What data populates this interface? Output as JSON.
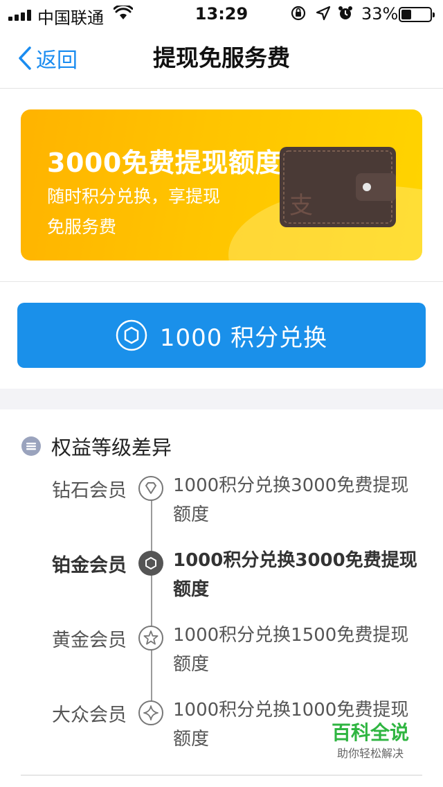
{
  "status_bar": {
    "carrier": "中国联通",
    "time": "13:29",
    "battery_percent": "33%"
  },
  "nav": {
    "back_label": "返回",
    "title": "提现免服务费"
  },
  "banner": {
    "title": "3000免费提现额度",
    "subtitle": "随时积分兑换，享提现免服务费"
  },
  "exchange_button": {
    "label": "1000 积分兑换"
  },
  "benefits": {
    "title": "权益等级差异",
    "tiers": [
      {
        "name": "钻石会员",
        "desc": "1000积分兑换3000免费提现额度",
        "icon": "diamond-icon",
        "active": false
      },
      {
        "name": "铂金会员",
        "desc": "1000积分兑换3000免费提现额度",
        "icon": "hexagon-icon",
        "active": true
      },
      {
        "name": "黄金会员",
        "desc": "1000积分兑换1500免费提现额度",
        "icon": "star-icon",
        "active": false
      },
      {
        "name": "大众会员",
        "desc": "1000积分兑换1000免费提现额度",
        "icon": "sparkle-icon",
        "active": false
      }
    ]
  },
  "watermark": {
    "title": "百科全说",
    "subtitle": "助你轻松解决"
  },
  "colors": {
    "accent": "#1a90ea",
    "banner_yellow": "#ffc400",
    "watermark_green": "#2fb541"
  }
}
